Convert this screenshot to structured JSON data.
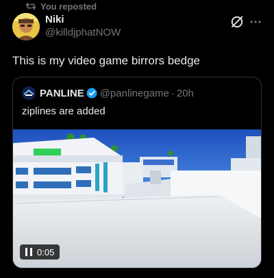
{
  "repost": {
    "label": "You reposted",
    "icon": "repost-icon"
  },
  "tweet": {
    "author_name": "Niki",
    "author_handle": "@killdjphatNOW",
    "text": "This is my video game birrors bedge",
    "icons": [
      "grok-icon",
      "more-icon"
    ]
  },
  "quote": {
    "author_name": "PANLINE",
    "author_handle": "@panlinegame",
    "separator": "·",
    "time": "20h",
    "text": "ziplines are added",
    "verified": true
  },
  "video": {
    "time": "0:05",
    "state": "playing"
  },
  "colors": {
    "background": "#000000",
    "text_primary": "#e7e9ea",
    "text_secondary": "#71767b",
    "border": "#2f3336",
    "verified": "#1d9bf0"
  }
}
